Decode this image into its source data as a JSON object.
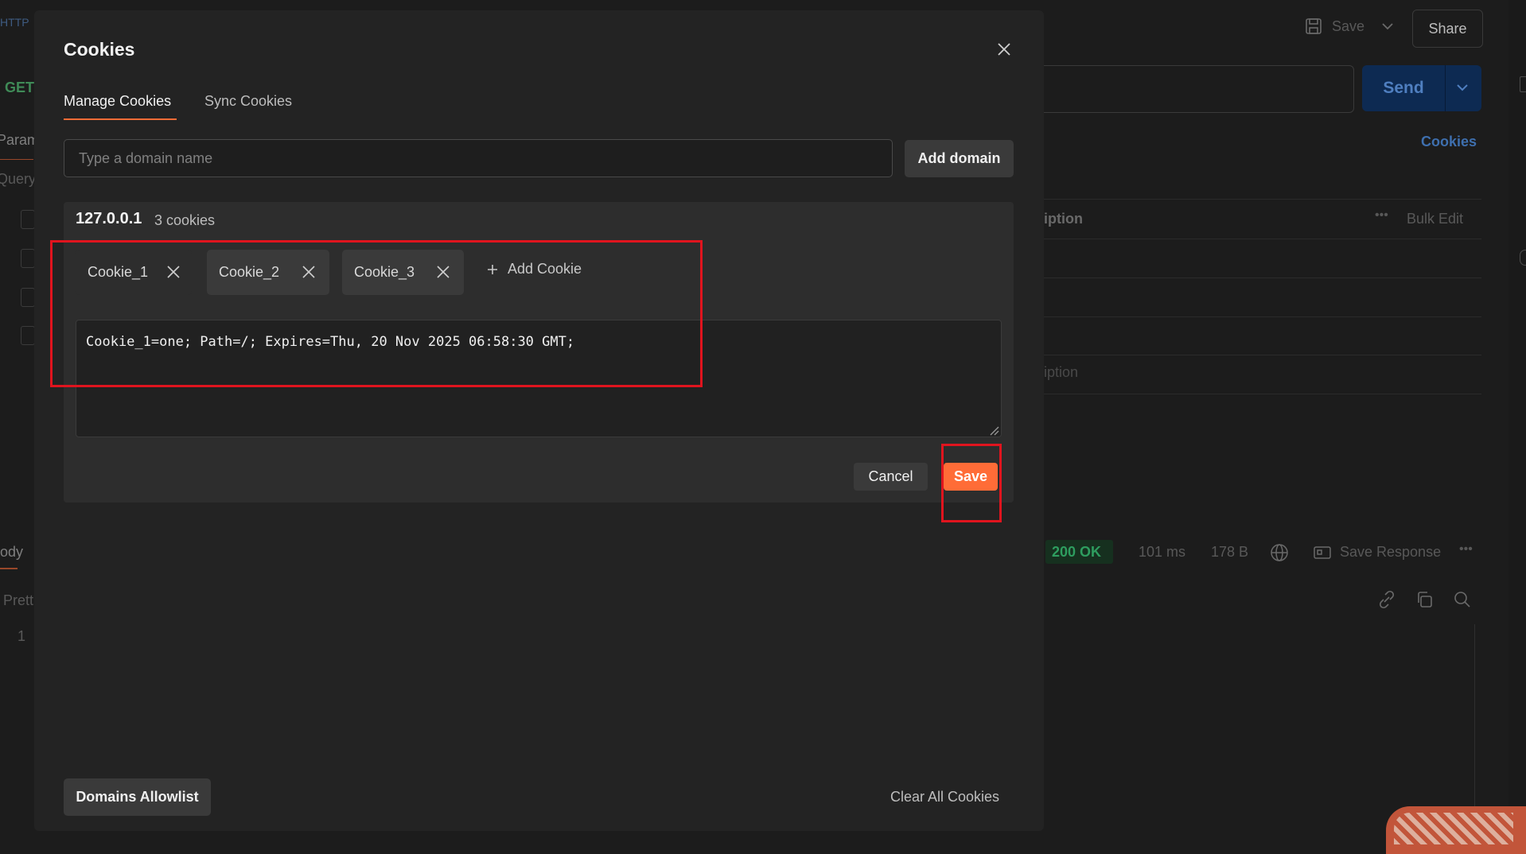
{
  "background": {
    "method": "GET",
    "sidebar_tabs": [
      "Param",
      "Query"
    ],
    "body_tab": "ody",
    "pretty_tab": "Prett",
    "line_number": "1",
    "save_label": "Save",
    "share_label": "Share",
    "send_label": "Send",
    "cookies_link": "Cookies",
    "description_header": "iption",
    "bulk_edit": "Bulk Edit",
    "description_placeholder": "iption",
    "response": {
      "status": "200 OK",
      "time": "101 ms",
      "size": "178 B",
      "save_response": "Save Response"
    }
  },
  "modal": {
    "title": "Cookies",
    "tabs": [
      {
        "label": "Manage Cookies"
      },
      {
        "label": "Sync Cookies"
      }
    ],
    "domain_input_placeholder": "Type a domain name",
    "add_domain_label": "Add domain",
    "domain": {
      "name": "127.0.0.1",
      "count": "3 cookies",
      "cookies": [
        {
          "label": "Cookie_1"
        },
        {
          "label": "Cookie_2"
        },
        {
          "label": "Cookie_3"
        }
      ],
      "add_cookie_label": "Add Cookie",
      "editor_value": "Cookie_1=one; Path=/; Expires=Thu, 20 Nov 2025 06:58:30 GMT;"
    },
    "cancel_label": "Cancel",
    "save_label": "Save",
    "domains_allowlist_label": "Domains Allowlist",
    "clear_all_label": "Clear All Cookies"
  },
  "colors": {
    "accent": "#ff6c37",
    "highlight": "#e0141e",
    "status_ok": "#2e9d5f"
  },
  "icons": [
    "close-icon",
    "chip-close-icon",
    "plus-icon",
    "save-icon",
    "chevron-down-icon",
    "globe-icon",
    "link-icon",
    "copy-icon",
    "search-icon",
    "more-icon",
    "resize-grip-icon"
  ]
}
